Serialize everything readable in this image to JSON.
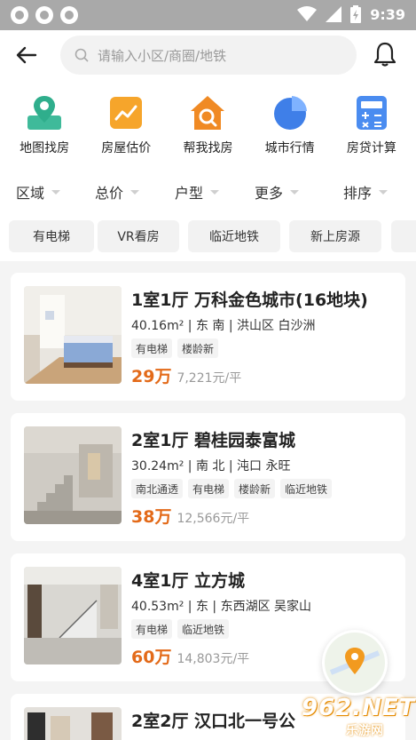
{
  "status_bar": {
    "time": "9:39"
  },
  "search": {
    "placeholder": "请输入小区/商圈/地铁"
  },
  "quick_actions": [
    {
      "label": "地图找房",
      "icon": "map-pin-icon"
    },
    {
      "label": "房屋估价",
      "icon": "trend-chart-icon"
    },
    {
      "label": "帮我找房",
      "icon": "house-search-icon"
    },
    {
      "label": "城市行情",
      "icon": "pie-chart-icon"
    },
    {
      "label": "房贷计算",
      "icon": "calculator-icon"
    }
  ],
  "filters": [
    "区域",
    "总价",
    "户型",
    "更多",
    "排序"
  ],
  "tags": [
    "有电梯",
    "VR看房",
    "临近地铁",
    "新上房源"
  ],
  "listings": [
    {
      "title": "1室1厅 万科金色城市(16地块)",
      "area": "40.16",
      "area_unit": "m²",
      "details": "东 南 | 洪山区 白沙洲",
      "tags": [
        "有电梯",
        "楼龄新"
      ],
      "price": "29万",
      "unit_price": "7,221元/平"
    },
    {
      "title": "2室1厅 碧桂园泰富城",
      "area": "30.24",
      "area_unit": "m²",
      "details": "南 北 | 沌口 永旺",
      "tags": [
        "南北通透",
        "有电梯",
        "楼龄新",
        "临近地铁"
      ],
      "price": "38万",
      "unit_price": "12,566元/平"
    },
    {
      "title": "4室1厅 立方城",
      "area": "40.53",
      "area_unit": "m²",
      "details": "东 | 东西湖区 吴家山",
      "tags": [
        "有电梯",
        "临近地铁"
      ],
      "price": "60万",
      "unit_price": "14,803元/平"
    },
    {
      "title": "2室2厅 汉口北一号公",
      "area": "",
      "area_unit": "",
      "details": "",
      "tags": [],
      "price": "",
      "unit_price": ""
    }
  ],
  "watermark": {
    "text": "962.NET",
    "sub": "乐游网"
  },
  "colors": {
    "accent": "#e36a19",
    "status_bar": "#a9a9a9",
    "background": "#f4f4f4"
  }
}
